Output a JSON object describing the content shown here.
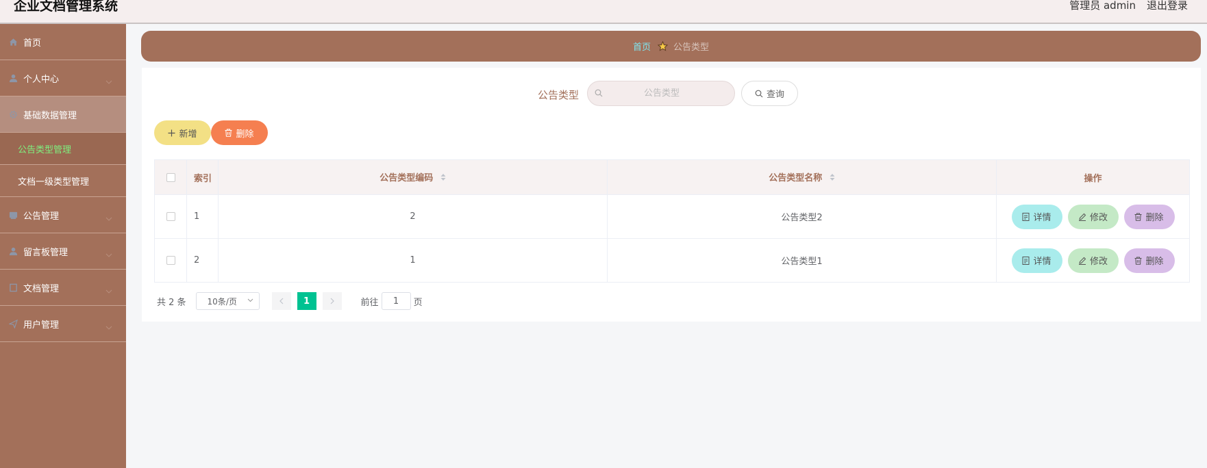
{
  "header": {
    "title": "企业文档管理系统",
    "user_label": "管理员 admin",
    "logout_label": "退出登录"
  },
  "sidebar": {
    "items": [
      {
        "label": "首页",
        "icon": "home-icon"
      },
      {
        "label": "个人中心",
        "icon": "user-icon"
      },
      {
        "label": "基础数据管理",
        "icon": "gear-icon"
      },
      {
        "label": "公告管理",
        "icon": "notice-icon"
      },
      {
        "label": "留言板管理",
        "icon": "message-user-icon"
      },
      {
        "label": "文档管理",
        "icon": "document-icon"
      },
      {
        "label": "用户管理",
        "icon": "send-icon"
      }
    ],
    "submenu": [
      {
        "label": "公告类型管理",
        "active": true
      },
      {
        "label": "文档一级类型管理",
        "active": false
      }
    ],
    "accent_active": "#7ff07f"
  },
  "breadcrumb": {
    "home": "首页",
    "current": "公告类型"
  },
  "search": {
    "label": "公告类型",
    "placeholder": "公告类型",
    "query_label": "查询"
  },
  "actions": {
    "add_label": "新增",
    "delete_label": "删除"
  },
  "table": {
    "headers": {
      "index": "索引",
      "code": "公告类型编码",
      "name": "公告类型名称",
      "ops": "操作"
    },
    "rows": [
      {
        "index": "1",
        "code": "2",
        "name": "公告类型2"
      },
      {
        "index": "2",
        "code": "1",
        "name": "公告类型1"
      }
    ],
    "op_labels": {
      "detail": "详情",
      "edit": "修改",
      "delete": "删除"
    }
  },
  "pagination": {
    "total": "共 2 条",
    "page_size": "10条/页",
    "current_page": "1",
    "goto_prefix": "前往",
    "goto_value": "1",
    "goto_suffix": "页"
  },
  "colors": {
    "brand": "#a3705a",
    "page_active": "#00c292",
    "add_button": "#f3e085",
    "delete_button": "#f57f50"
  }
}
